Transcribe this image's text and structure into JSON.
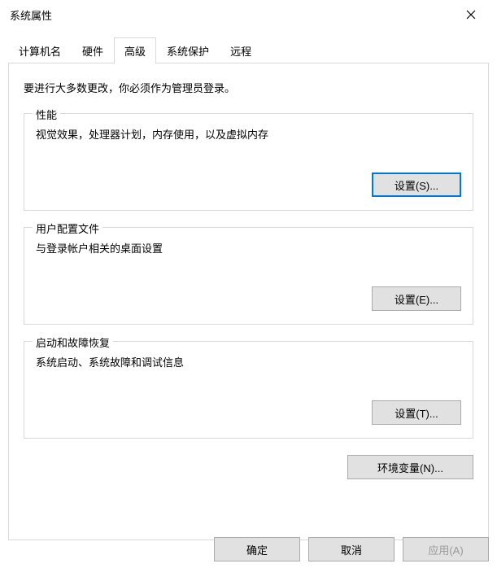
{
  "window": {
    "title": "系统属性"
  },
  "tabs": {
    "computer_name": "计算机名",
    "hardware": "硬件",
    "advanced": "高级",
    "system_protection": "系统保护",
    "remote": "远程"
  },
  "content": {
    "intro": "要进行大多数更改，你必须作为管理员登录。",
    "performance": {
      "legend": "性能",
      "desc": "视觉效果，处理器计划，内存使用，以及虚拟内存",
      "button": "设置(S)..."
    },
    "profiles": {
      "legend": "用户配置文件",
      "desc": "与登录帐户相关的桌面设置",
      "button": "设置(E)..."
    },
    "startup": {
      "legend": "启动和故障恢复",
      "desc": "系统启动、系统故障和调试信息",
      "button": "设置(T)..."
    },
    "env_button": "环境变量(N)..."
  },
  "footer": {
    "ok": "确定",
    "cancel": "取消",
    "apply": "应用(A)"
  }
}
